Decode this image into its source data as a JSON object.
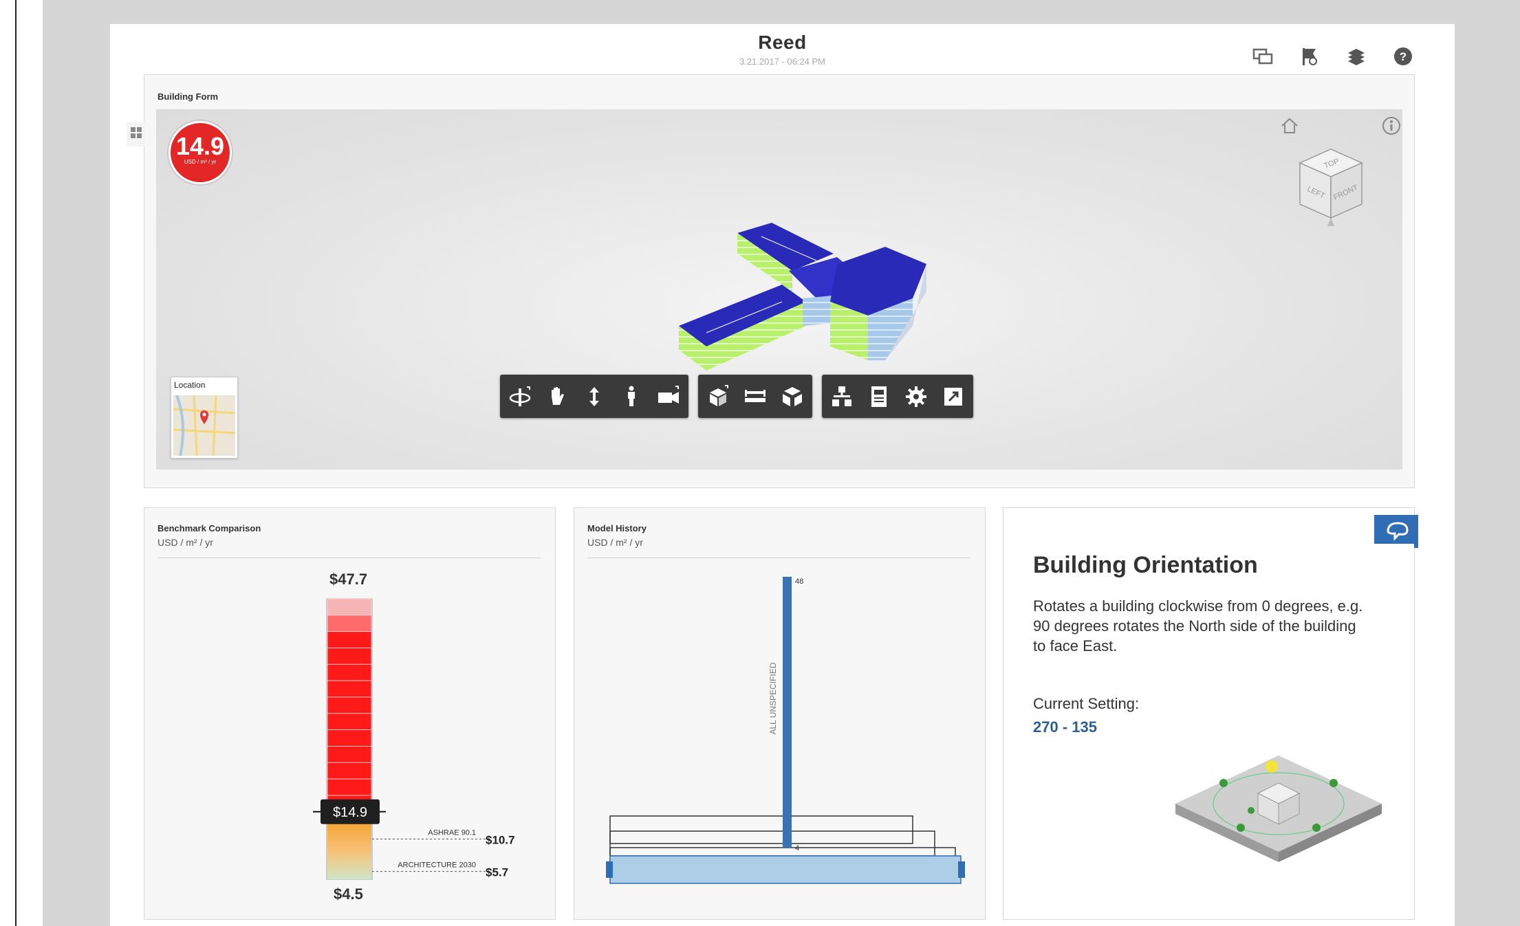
{
  "header": {
    "title": "Reed",
    "date": "3.21.2017 - 06:24 PM",
    "icons": [
      "compare-icon",
      "flag-icon",
      "layers-icon",
      "help-icon"
    ]
  },
  "building_form": {
    "title": "Building Form",
    "eui_value": "14.9",
    "eui_unit": "USD / m² / yr",
    "location_label": "Location",
    "view_cube": {
      "top": "TOP",
      "left": "LEFT",
      "front": "FRONT"
    },
    "toolbar_groups": [
      [
        "orbit-icon",
        "pan-icon",
        "zoom-icon",
        "walk-icon",
        "camera-icon"
      ],
      [
        "section-box-icon",
        "measure-icon",
        "explode-icon"
      ],
      [
        "model-browser-icon",
        "properties-icon",
        "settings-icon",
        "fullscreen-icon"
      ]
    ]
  },
  "benchmark": {
    "title": "Benchmark Comparison",
    "units": "USD / m² / yr",
    "top_value": "$47.7",
    "bottom_value": "$4.5",
    "current_value": "$14.9",
    "current": 14.9,
    "max": 47.7,
    "min": 4.5,
    "markers": [
      {
        "label": "ASHRAE 90.1",
        "value": "$10.7",
        "number": 10.7
      },
      {
        "label": "ARCHITECTURE 2030",
        "value": "$5.7",
        "number": 5.7
      }
    ],
    "colors": {
      "red": "#ff1a1a",
      "orange": "#f5a623",
      "green": "#cfe6c8",
      "marker": "#1f1f1f"
    }
  },
  "model_history": {
    "title": "Model History",
    "units": "USD / m² / yr",
    "bar_label": "ALL UNSPECIFIED",
    "top_value": "48",
    "bottom_value": "4",
    "max": 48,
    "min": 4,
    "bar_color": "#3b72b4",
    "handle_color": "#2f6db5"
  },
  "orientation": {
    "title": "Building Orientation",
    "description": "Rotates a building clockwise from 0 degrees, e.g. 90 degrees rotates the North side of the building to face East.",
    "setting_label": "Current Setting:",
    "setting_value": "270 - 135",
    "accent": "#2f6db5"
  }
}
